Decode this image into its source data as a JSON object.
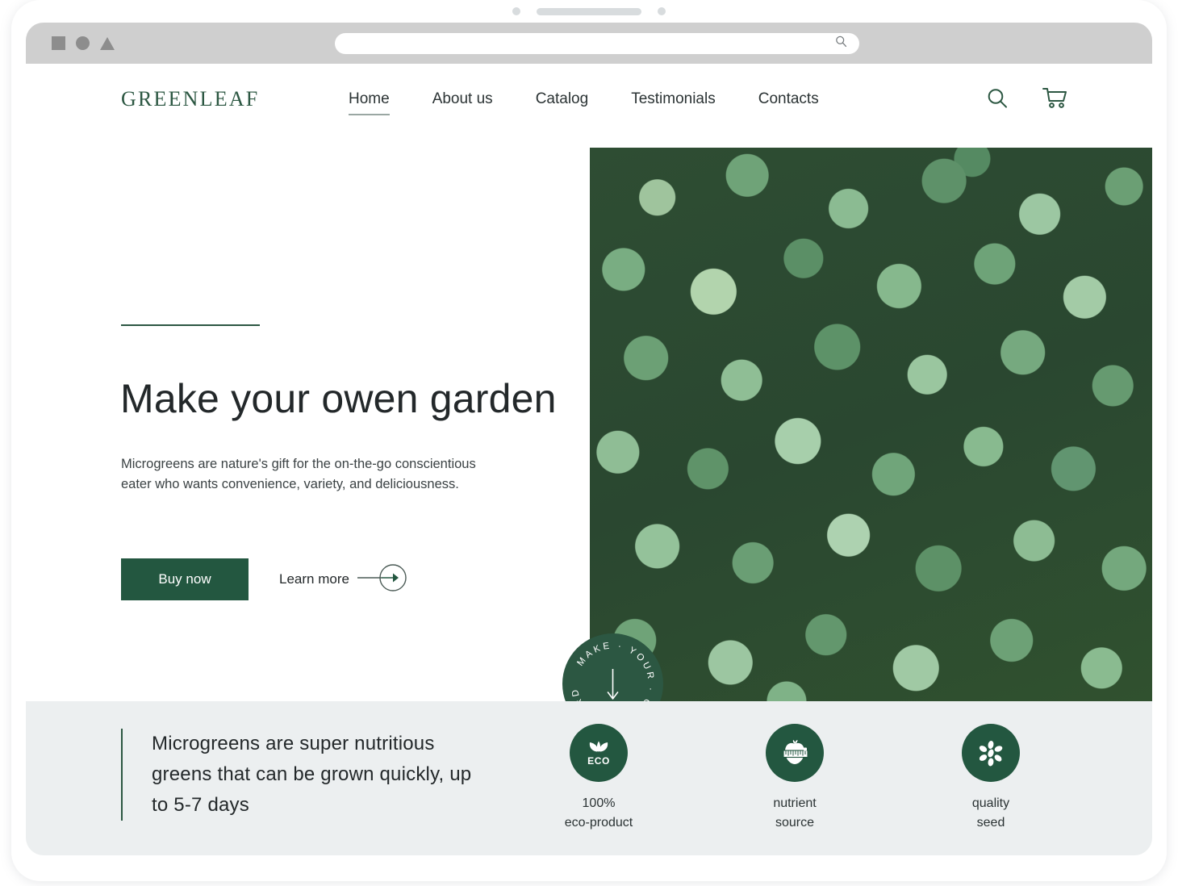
{
  "browser": {
    "window_controls": [
      "square",
      "circle",
      "triangle"
    ],
    "address_bar_value": "",
    "address_bar_icon": "search-icon"
  },
  "site": {
    "logo": "GREENLEAF",
    "nav": [
      {
        "label": "Home",
        "active": true
      },
      {
        "label": "About us",
        "active": false
      },
      {
        "label": "Catalog",
        "active": false
      },
      {
        "label": "Testimonials",
        "active": false
      },
      {
        "label": "Contacts",
        "active": false
      }
    ],
    "header_actions": [
      {
        "icon": "search-icon"
      },
      {
        "icon": "shopping-cart-icon"
      }
    ],
    "hero": {
      "title": "Make your owen garden",
      "description": "Microgreens are nature's gift for the on-the-go conscientious eater who wants convenience, variety, and deliciousness.",
      "primary_cta": "Buy now",
      "secondary_cta": "Learn more",
      "secondary_cta_icon": "arrow-right-circle-icon",
      "scroll_badge": {
        "text": "MAKE · YOUR · OWEN · GARDE",
        "icon": "arrow-down-icon"
      },
      "image_alt": "microgreens"
    },
    "features": {
      "quote": "Microgreens are super nutritious greens that can be grown quickly, up to 5-7 days",
      "items": [
        {
          "icon": "eco-leaf-icon",
          "label_line1": "100%",
          "label_line2": "eco-product"
        },
        {
          "icon": "apple-measure-icon",
          "label_line1": "nutrient",
          "label_line2": "source"
        },
        {
          "icon": "seeds-icon",
          "label_line1": "quality",
          "label_line2": "seed"
        }
      ]
    }
  },
  "colors": {
    "brand_green": "#235740",
    "logo_green": "#2c5742",
    "band_bg": "#eceff0",
    "text_dark": "#23282a"
  }
}
